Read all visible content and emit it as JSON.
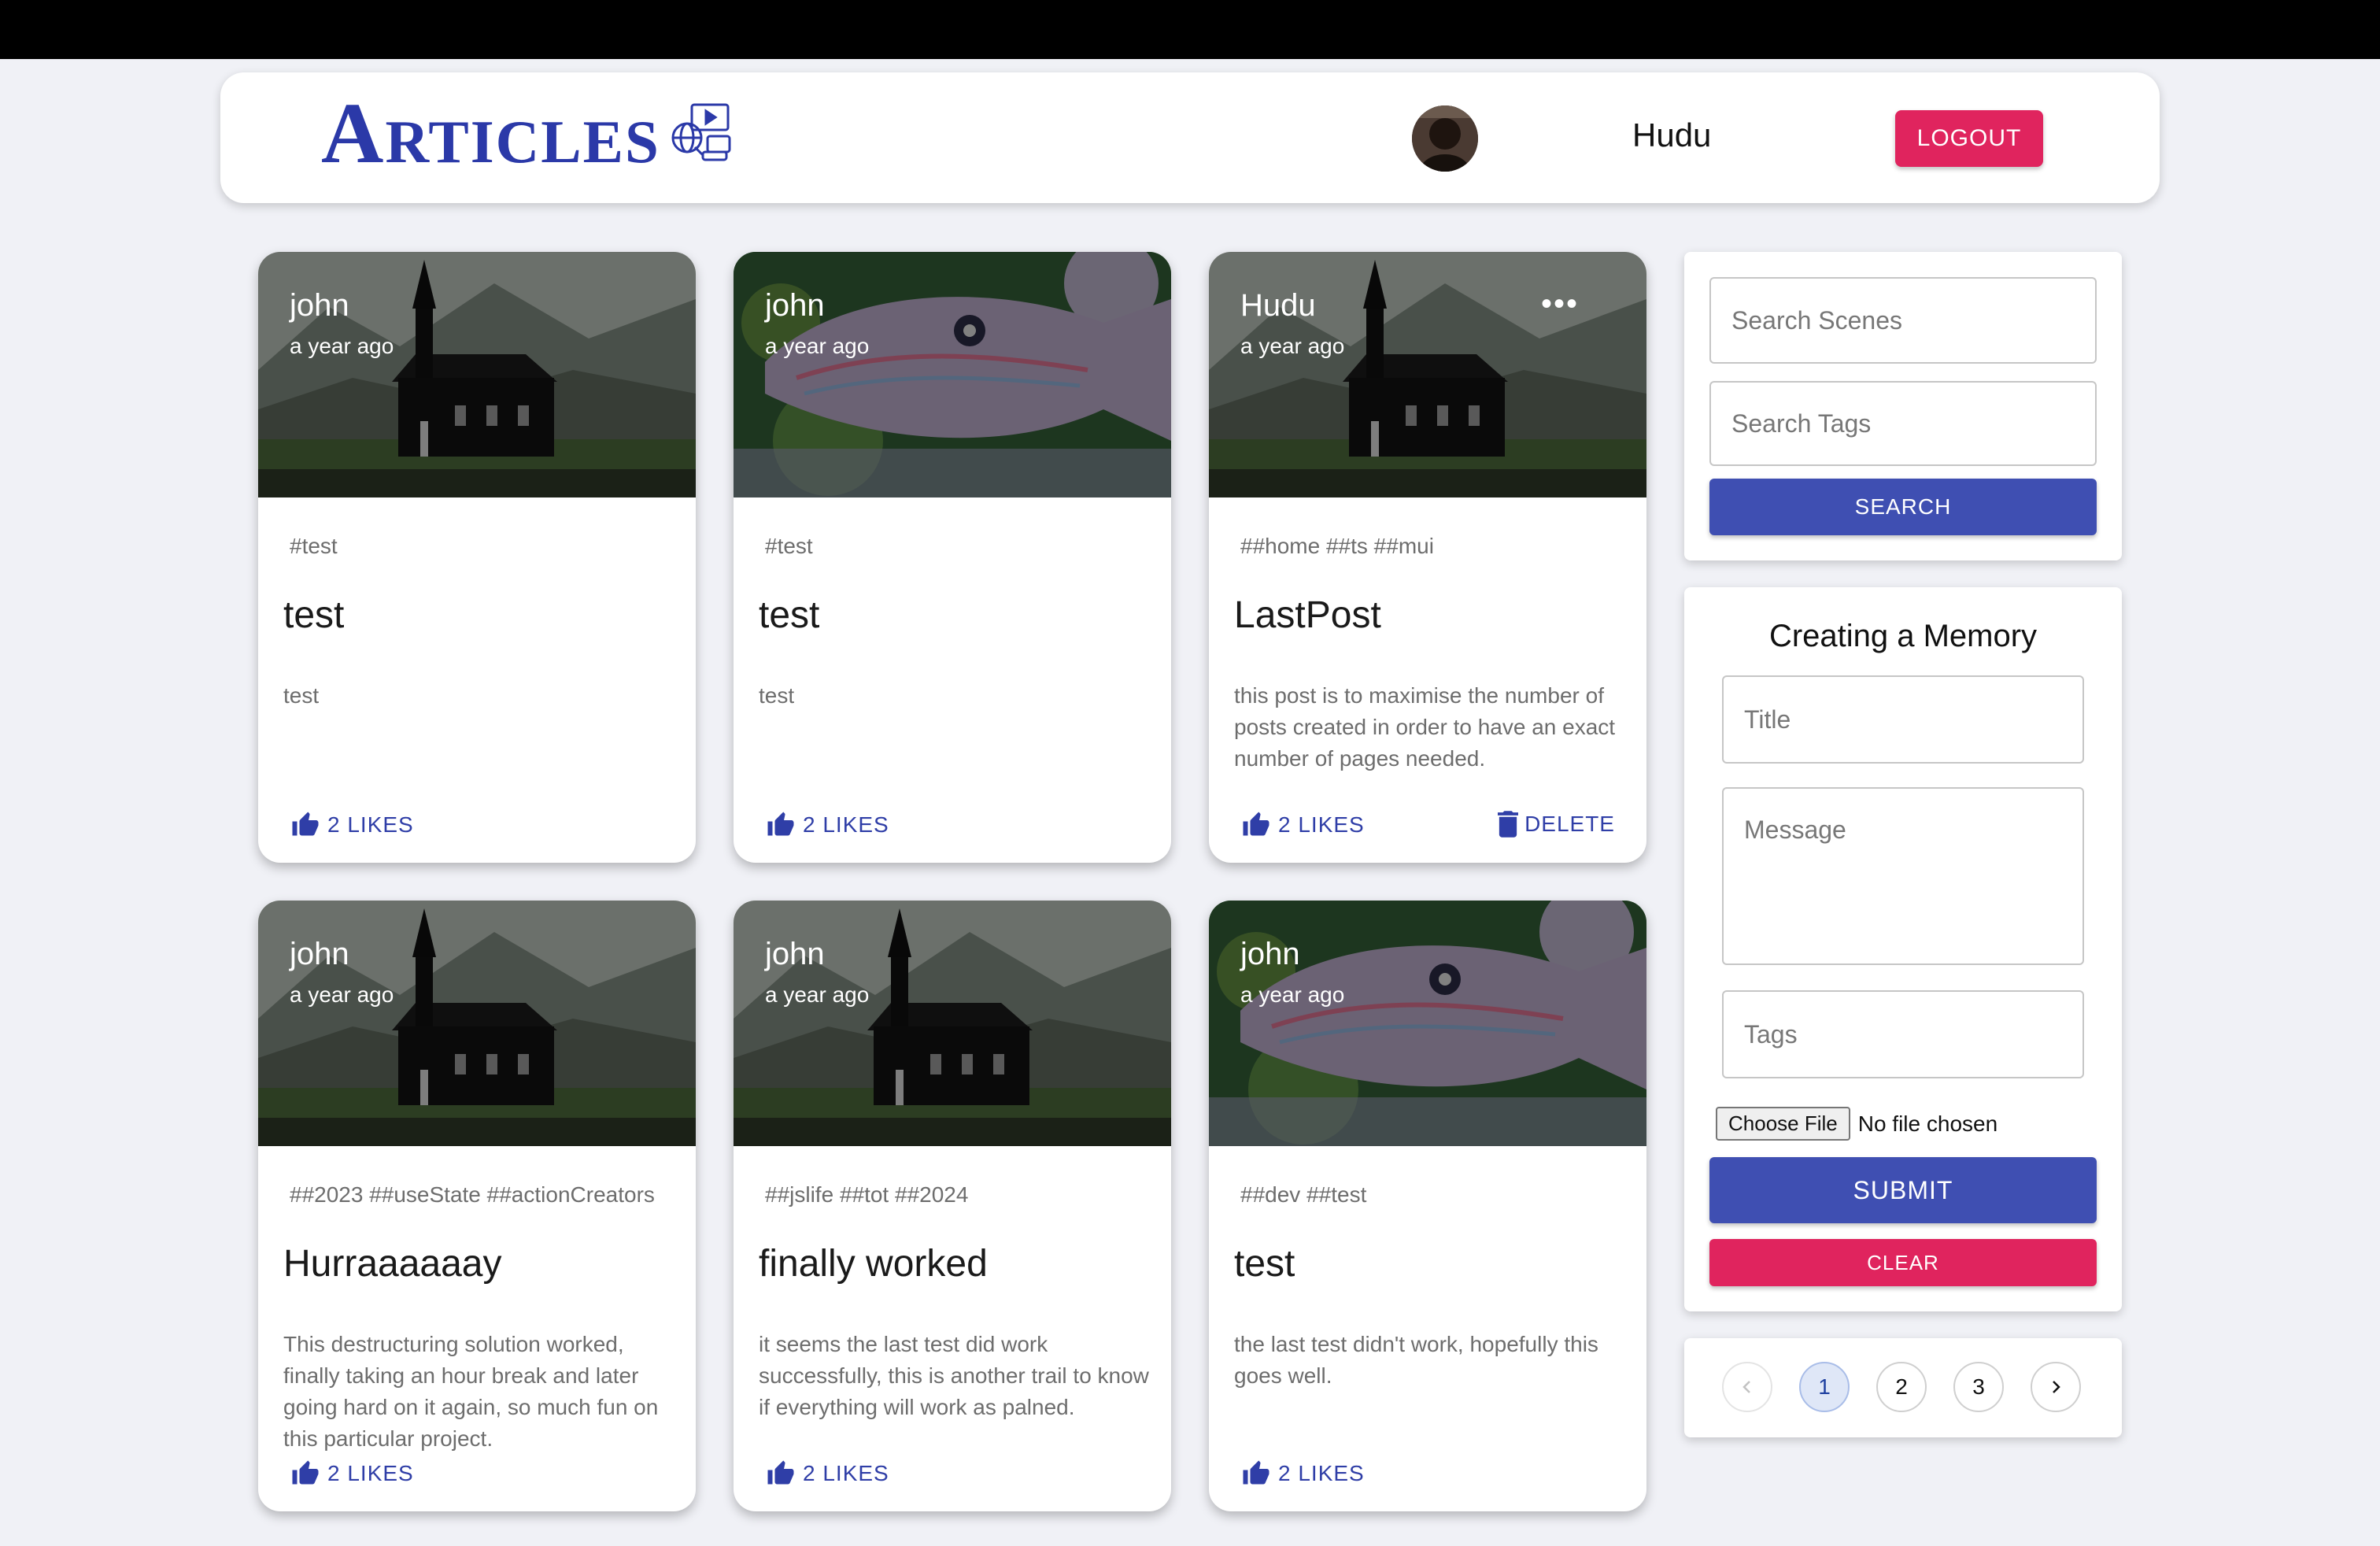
{
  "header": {
    "brand_title": "Articles",
    "username": "Hudu",
    "logout_label": "LOGOUT"
  },
  "posts": [
    {
      "author": "john",
      "time": "a year ago",
      "tags": "#test",
      "title": "test",
      "message": "test",
      "likes": "2 LIKES",
      "image": "church",
      "owner": false
    },
    {
      "author": "john",
      "time": "a year ago",
      "tags": "#test",
      "title": "test",
      "message": "test",
      "likes": "2 LIKES",
      "image": "fish",
      "owner": false
    },
    {
      "author": "Hudu",
      "time": "a year ago",
      "tags": "##home ##ts ##mui",
      "title": "LastPost",
      "message": "this post is to maximise the number of posts created in order to have an exact number of pages needed.",
      "likes": "2 LIKES",
      "delete": "DELETE",
      "image": "church",
      "owner": true
    },
    {
      "author": "john",
      "time": "a year ago",
      "tags": "##2023 ##useState ##actionCreators",
      "title": "Hurraaaaaay",
      "message": "This destructuring solution worked, finally taking an hour break and later going hard on it again, so much fun on this particular project.",
      "likes": "2 LIKES",
      "image": "church",
      "owner": false
    },
    {
      "author": "john",
      "time": "a year ago",
      "tags": "##jslife ##tot ##2024",
      "title": "finally worked",
      "message": "it seems the last test did work successfully, this is another trail to know if everything will work as palned.",
      "likes": "2 LIKES",
      "image": "church",
      "owner": false
    },
    {
      "author": "john",
      "time": "a year ago",
      "tags": "##dev ##test",
      "title": "test",
      "message": "the last test didn't work, hopefully this goes well.",
      "likes": "2 LIKES",
      "image": "fish",
      "owner": false
    }
  ],
  "search": {
    "scenes_placeholder": "Search Scenes",
    "tags_placeholder": "Search Tags",
    "button_label": "SEARCH"
  },
  "form": {
    "heading": "Creating a Memory",
    "title_placeholder": "Title",
    "message_placeholder": "Message",
    "tags_placeholder": "Tags",
    "file_button": "Choose File",
    "file_status": "No file chosen",
    "submit_label": "SUBMIT",
    "clear_label": "CLEAR"
  },
  "pagination": {
    "pages": [
      "1",
      "2",
      "3"
    ],
    "current": "1"
  },
  "colors": {
    "brand": "#2b39a8",
    "primary": "#3f4fb2",
    "danger": "#e0245e",
    "background": "#f0f1f6"
  }
}
